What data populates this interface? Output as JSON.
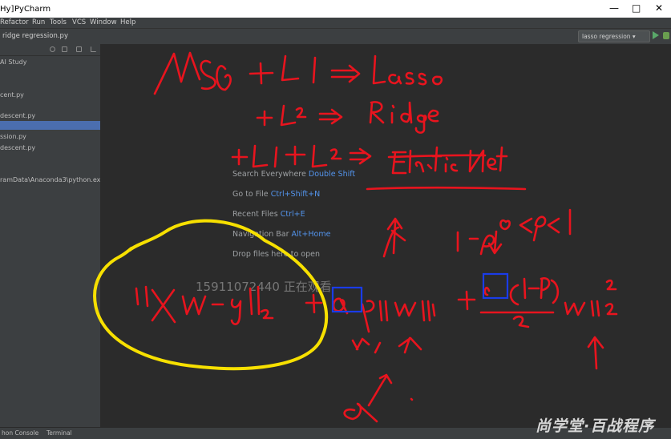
{
  "window": {
    "title_prefix": "Hy]",
    "app_title": "PyCharm",
    "minimize": "—",
    "maximize": "□",
    "close": "✕"
  },
  "menu": {
    "items": [
      "Refactor",
      "Run",
      "Tools",
      "VCS",
      "Window",
      "Help"
    ]
  },
  "navbar": {
    "file_label": "ridge regression.py"
  },
  "run_config": {
    "label": "lasso regression ▾"
  },
  "sidebar": {
    "items": [
      {
        "label": "AI Study",
        "selected": false
      },
      {
        "label": "cent.py",
        "selected": false
      },
      {
        "label": "descent.py",
        "selected": false
      },
      {
        "label": "",
        "selected": true
      },
      {
        "label": "ssion.py",
        "selected": false
      },
      {
        "label": "descent.py",
        "selected": false
      },
      {
        "label": "ramData\\Anaconda3\\python.exe",
        "selected": false
      }
    ]
  },
  "editor_hints": [
    {
      "label": "Search Everywhere",
      "shortcut": "Double Shift"
    },
    {
      "label": "Go to File",
      "shortcut": "Ctrl+Shift+N"
    },
    {
      "label": "Recent Files",
      "shortcut": "Ctrl+E"
    },
    {
      "label": "Navigation Bar",
      "shortcut": "Alt+Home"
    },
    {
      "label": "Drop files here to open",
      "shortcut": ""
    }
  ],
  "watermark": "15911072440 正在观看",
  "statusbar": {
    "python_console": "hon Console",
    "terminal": "Terminal"
  },
  "brand": "尚学堂·百战程序",
  "colors": {
    "ink_red": "#e8141e",
    "ink_yellow": "#f7e000",
    "ink_blue": "#1a3ce8",
    "selection": "#4b6eaf"
  },
  "annotation_icons": [
    "handwritten-ink"
  ]
}
